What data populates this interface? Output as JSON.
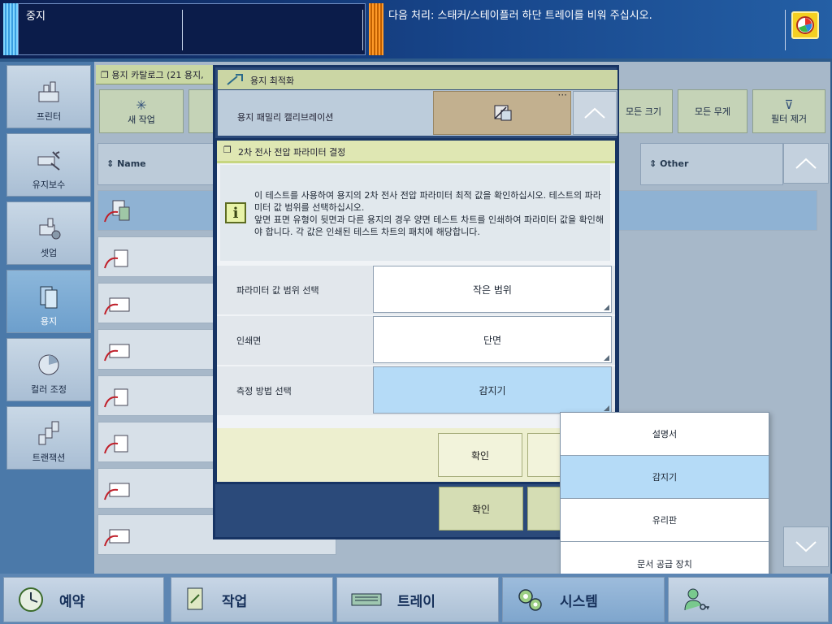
{
  "topbar": {
    "status": "중지",
    "message": "다음 처리: 스태커/스테이플러 하단 트레이를 비워 주십시오."
  },
  "nav": {
    "items": [
      {
        "label": "프린터",
        "icon": "printer-icon"
      },
      {
        "label": "유지보수",
        "icon": "maintenance-icon"
      },
      {
        "label": "셋업",
        "icon": "setup-icon"
      },
      {
        "label": "용지",
        "icon": "media-icon",
        "active": true
      },
      {
        "label": "컬러 조정",
        "icon": "color-adjust-icon"
      },
      {
        "label": "트랜잭션",
        "icon": "transaction-icon"
      }
    ]
  },
  "catalog": {
    "header": "용지 카탈로그 (21 용지,",
    "new_job": "새 작업",
    "all_sizes": "모든 크기",
    "all_weights": "모든 무게",
    "clear_filter": "필터 제거",
    "col_name": "Name",
    "col_other": "Other"
  },
  "dialog_optimize": {
    "title": "용지 최적화",
    "calibration_label": "용지 패밀리 캘리브레이션",
    "confirm": "확인"
  },
  "dialog_voltage": {
    "title": "2차 전사 전압 파라미터 결정",
    "info_line1": "이 테스트를 사용하여 용지의 2차 전사 전압 파라미터 최적 값을 확인하십시오. 테스트의 파라미터 값 범위를 선택하십시오.",
    "info_line2": "앞면 표면 유형이 뒷면과 다른 용지의 경우 양면 테스트 차트를 인쇄하여 파라미터 값을 확인해야 합니다. 각 값은 인쇄된 테스트 차트의 패치에 해당합니다.",
    "fields": [
      {
        "label": "파라미터 값 범위 선택",
        "value": "작은 범위"
      },
      {
        "label": "인쇄면",
        "value": "단면"
      },
      {
        "label": "측정 방법 선택",
        "value": "감지기"
      }
    ],
    "confirm": "확인"
  },
  "dropdown": {
    "options": [
      "설명서",
      "감지기",
      "유리판",
      "문서 공급 장치"
    ],
    "selected": "감지기"
  },
  "bottombar": {
    "items": [
      {
        "label": "예약",
        "icon": "clock-icon"
      },
      {
        "label": "작업",
        "icon": "job-icon"
      },
      {
        "label": "트레이",
        "icon": "tray-icon"
      },
      {
        "label": "시스템",
        "icon": "system-gears-icon",
        "active": true
      },
      {
        "label": "",
        "icon": "user-key-icon"
      }
    ]
  }
}
